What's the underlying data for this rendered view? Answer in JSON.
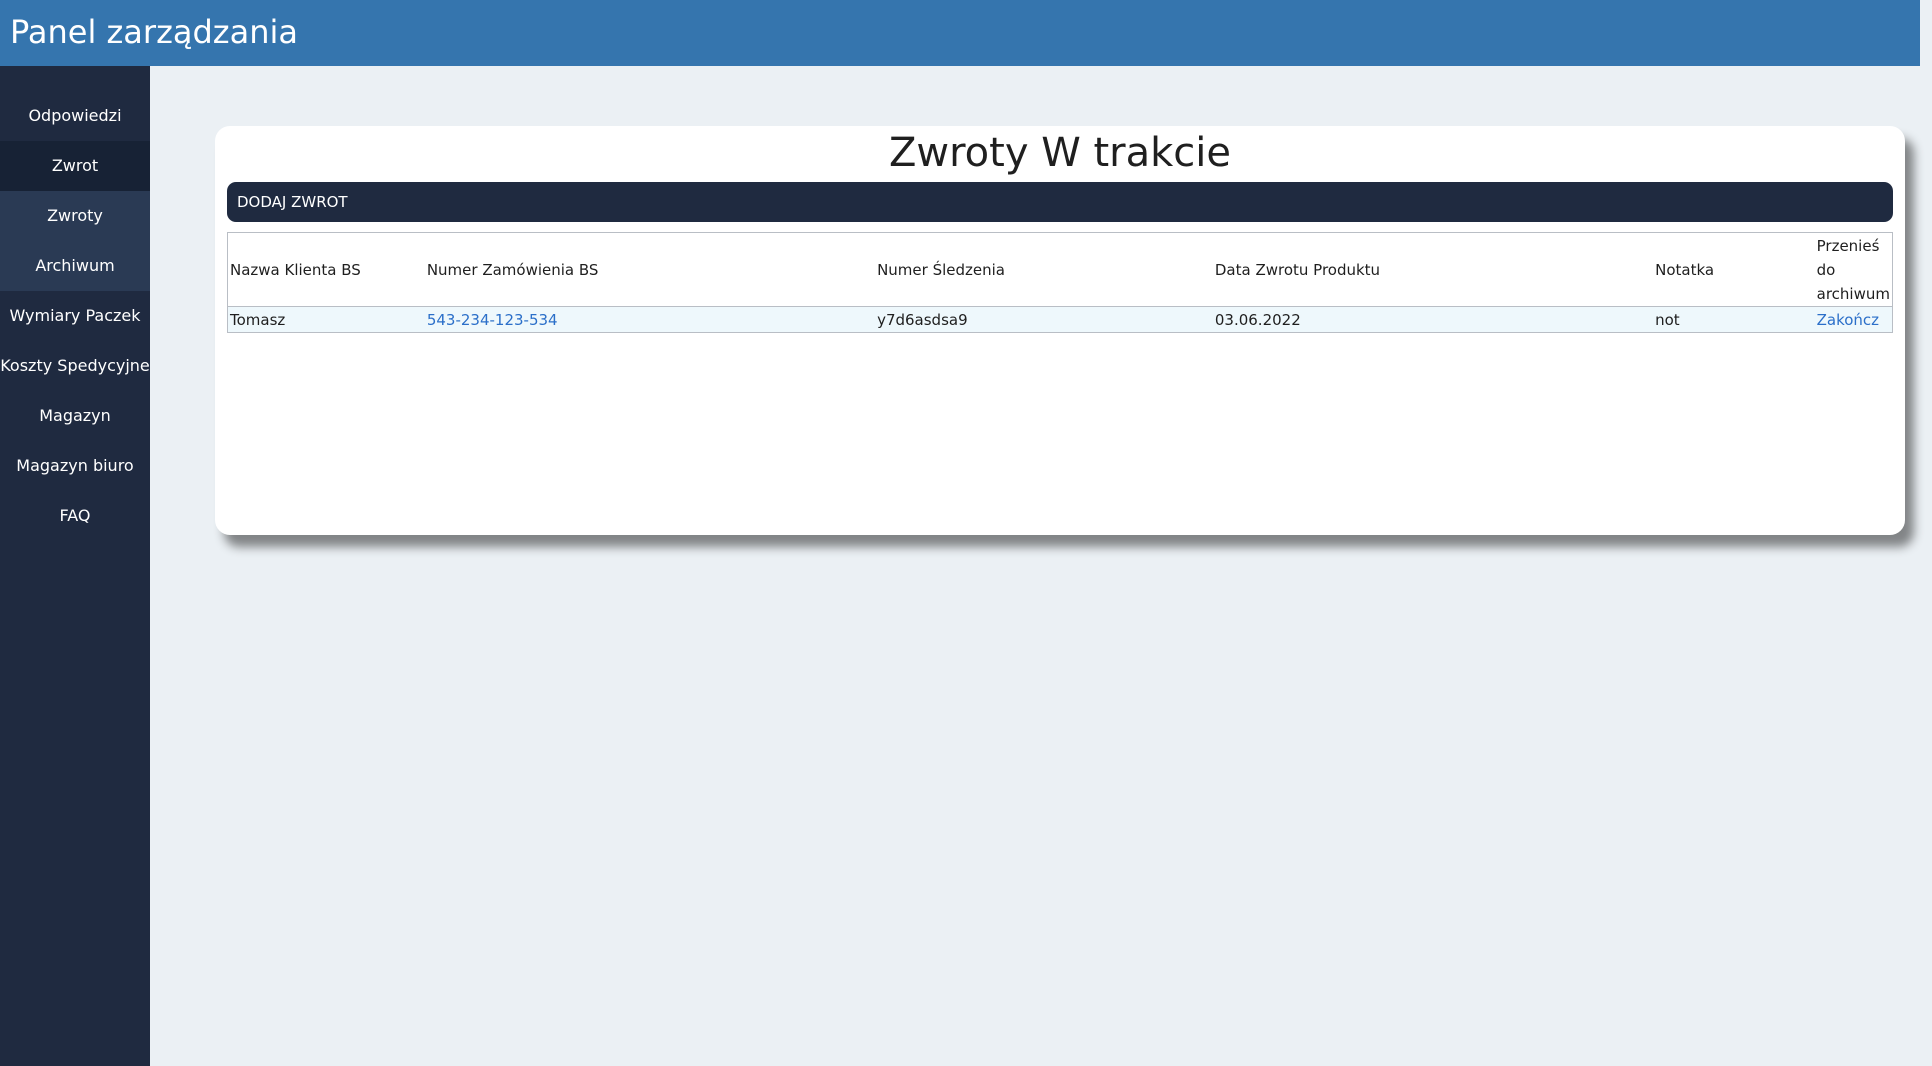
{
  "header": {
    "title": "Panel zarządzania"
  },
  "sidebar": {
    "items": [
      {
        "label": "Odpowiedzi"
      },
      {
        "label": "Zwrot"
      },
      {
        "label": "Zwroty"
      },
      {
        "label": "Archiwum"
      },
      {
        "label": "Wymiary Paczek"
      },
      {
        "label": "Koszty Spedycyjne"
      },
      {
        "label": "Magazyn"
      },
      {
        "label": "Magazyn biuro"
      },
      {
        "label": "FAQ"
      }
    ]
  },
  "main": {
    "title": "Zwroty W trakcie",
    "add_button_label": "DODAJ ZWROT",
    "table": {
      "columns": [
        "Nazwa Klienta BS",
        "Numer Zamówienia BS",
        "Numer Śledzenia",
        "Data Zwrotu Produktu",
        "Notatka",
        "Przenieś do archiwum"
      ],
      "rows": [
        {
          "client": "Tomasz",
          "order": "543-234-123-534",
          "tracking": "y7d6asdsa9",
          "date": "03.06.2022",
          "note": "not",
          "action": "Zakończ"
        }
      ]
    }
  },
  "colors": {
    "header": "#3575ae",
    "sidebar": "#1f2a40",
    "background": "#ebf0f4",
    "link": "#2b6fc9"
  }
}
